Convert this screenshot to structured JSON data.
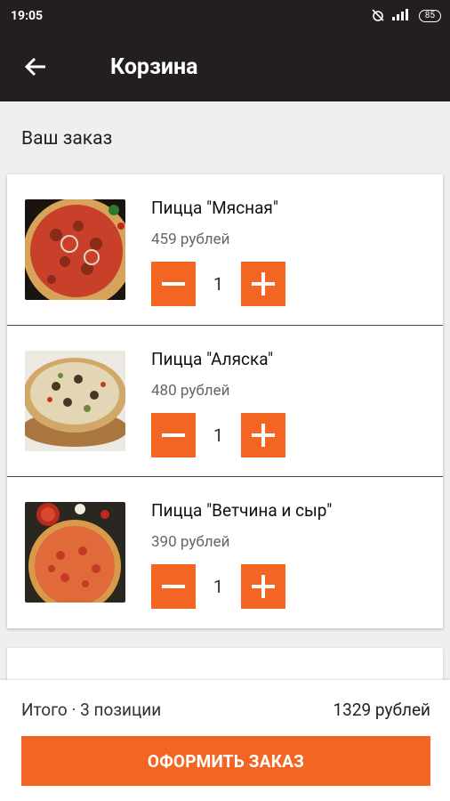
{
  "status_bar": {
    "time": "19:05",
    "battery": "85"
  },
  "app_bar": {
    "title": "Корзина"
  },
  "order": {
    "section_title": "Ваш заказ",
    "items": [
      {
        "name": "Пицца \"Мясная\"",
        "price": "459 рублей",
        "quantity": "1",
        "image": "pizza-meat"
      },
      {
        "name": "Пицца \"Аляска\"",
        "price": "480 рублей",
        "quantity": "1",
        "image": "pizza-alaska"
      },
      {
        "name": "Пицца \"Ветчина и сыр\"",
        "price": "390 рублей",
        "quantity": "1",
        "image": "pizza-ham-cheese"
      }
    ]
  },
  "footer": {
    "total_label": "Итого · 3 позиции",
    "total_value": "1329 рублей",
    "checkout_label": "ОФОРМИТЬ ЗАКАЗ"
  },
  "colors": {
    "accent": "#f26522",
    "appbar": "#231f20"
  }
}
